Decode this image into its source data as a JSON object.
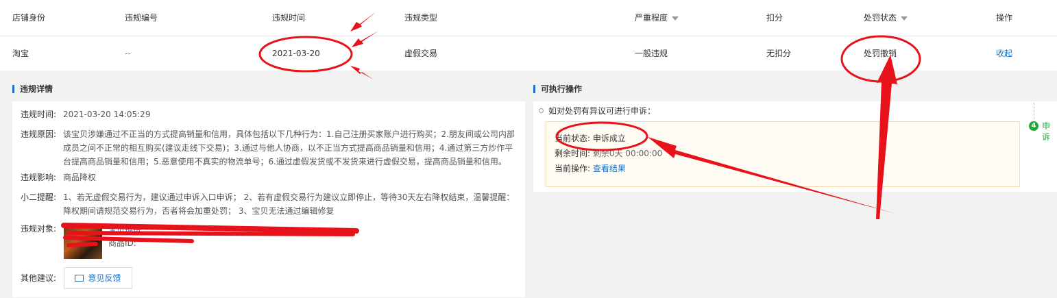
{
  "table": {
    "headers": {
      "shop_identity": "店铺身份",
      "violation_no": "违规编号",
      "violation_time": "违规时间",
      "violation_type": "违规类型",
      "severity": "严重程度",
      "deduction": "扣分",
      "penalty_status": "处罚状态",
      "action": "操作"
    },
    "row": {
      "shop_identity": "淘宝",
      "violation_no": "--",
      "violation_time": "2021-03-20",
      "violation_type": "虚假交易",
      "severity": "一般违规",
      "deduction": "无扣分",
      "penalty_status": "处罚撤销",
      "action": "收起"
    }
  },
  "details": {
    "title": "违规详情",
    "time_label": "违规时间:",
    "time_value": "2021-03-20 14:05:29",
    "reason_label": "违规原因:",
    "reason_lines": [
      "该宝贝涉嫌通过不正当的方式提高销量和信用，具体包括以下几种行为：1.自己注册买家账户进行购买；2.朋友间或公司内部",
      "成员之间不正常的相互购买(建议走线下交易)；3.通过与他人协商，以不正当方式提高商品销量和信用；4.通过第三方炒作平",
      "台提高商品销量和信用；5.恶意使用不真实的物流单号；6.通过虚假发货或不发货来进行虚假交易，提高商品销量和信用。"
    ],
    "impact_label": "违规影响:",
    "impact_value": "商品降权",
    "tip_label": "小二提醒:",
    "tip_lines": [
      "1、若无虚假交易行为，建议通过申诉入口申诉；  2、若有虚假交易行为建议立即停止，等待30天左右降权结束，温馨提醒：",
      "降权期间请规范交易行为，否者将会加重处罚；  3、宝贝无法通过编辑修复"
    ],
    "object_label": "违规对象:",
    "object_link": "宝贝链接 ……",
    "object_id": "商品ID:",
    "suggestion_label": "其他建议:",
    "feedback_button": "意见反馈"
  },
  "actions": {
    "title": "可执行操作",
    "intro": "如对处罚有异议可进行申诉：",
    "current_status_label": "当前状态:",
    "current_status_value": "申诉成立",
    "remaining_label": "剩余时间:",
    "remaining_value": "剩余0天 00:00:00",
    "current_op_label": "当前操作:",
    "current_op_value": "查看结果",
    "step_number": "4",
    "step_label": "申诉"
  },
  "colors": {
    "accent": "#1a73c8",
    "annotation_red": "#e8121b",
    "success_green": "#25a83a"
  }
}
